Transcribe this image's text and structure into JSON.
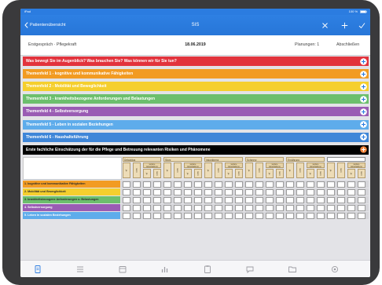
{
  "status_bar": {
    "left": "iPad",
    "right": "100 %"
  },
  "nav": {
    "back_label": "Patientenübersicht",
    "title": "SIS",
    "icons": [
      "close-icon",
      "plus-icon",
      "checkmark-icon"
    ]
  },
  "subheader": {
    "context": "Erstgespräch · Pflegekraft",
    "date": "18.06.2019",
    "plans": "Planungen: 1",
    "finish": "Abschließen"
  },
  "sections": [
    {
      "label": "Was bewegt Sie im Augenblick? Was brauchen Sie? Was können wir für Sie tun?",
      "color": "#e2333c"
    },
    {
      "label": "Themenfeld 1 - kognitive und kommunikative Fähigkeiten",
      "color": "#f29b22"
    },
    {
      "label": "Themenfeld 2 - Mobilität und Beweglichkeit",
      "color": "#f5cf2e"
    },
    {
      "label": "Themenfeld 3 - krankheitsbezogene Anforderungen und Belastungen",
      "color": "#6cbf6d"
    },
    {
      "label": "Themenfeld 4 - Selbstversorgung",
      "color": "#9a5cb4"
    },
    {
      "label": "Themenfeld 5 - Leben in sozialen Beziehungen",
      "color": "#5eaceb"
    },
    {
      "label": "Themenfeld 6 - Haushaltsführung",
      "color": "#3f86d8"
    }
  ],
  "risk_section": {
    "label": "Erste fachliche Einschätzung der für die Pflege und Betreuung relevanten Risiken und Phänomene",
    "color": "#000000",
    "button_color": "#f0833a"
  },
  "risk_matrix": {
    "risks": [
      "Dekubitus",
      "Sturz",
      "Inkontinenz",
      "Schmerz",
      "Ernährung"
    ],
    "other_value": "",
    "sub_labels": [
      "ja",
      "nein",
      "ja",
      "nein"
    ],
    "further_label": "weitere Einschätzung notwendig",
    "rows": [
      {
        "label": "1. kognitive und kommunikative Fähigkeiten",
        "color": "#f29b22",
        "text_color": "#2b2b2b"
      },
      {
        "label": "2. Mobilität und Beweglichkeit",
        "color": "#f5cf2e",
        "text_color": "#2b2b2b"
      },
      {
        "label": "3. krankheitsbezogene Anforderungen u. Belastungen",
        "color": "#6cbf6d",
        "text_color": "#2b2b2b"
      },
      {
        "label": "4. Selbstversorgung",
        "color": "#9a5cb4",
        "text_color": "#ffffff"
      },
      {
        "label": "5. Leben in sozialen Beziehungen",
        "color": "#5eaceb",
        "text_color": "#ffffff"
      }
    ]
  },
  "tabbar": {
    "icons": [
      "document-icon",
      "list-icon",
      "calendar-icon",
      "chart-icon",
      "clipboard-icon",
      "chat-icon",
      "folder-icon",
      "gear-icon"
    ],
    "active": 0,
    "accent": "#2b7ce0"
  }
}
